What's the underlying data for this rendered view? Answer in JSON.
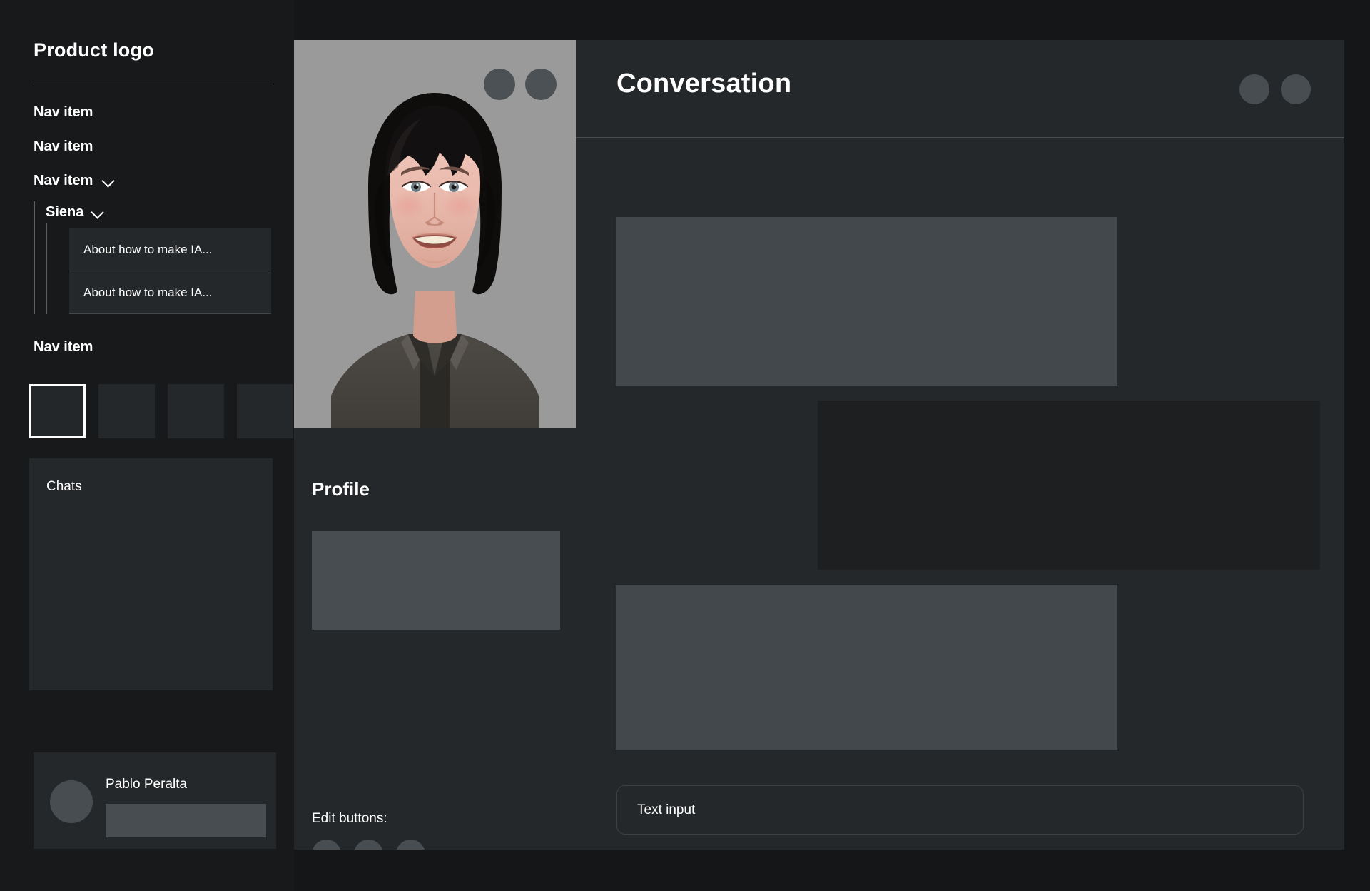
{
  "sidebar": {
    "logo": "Product logo",
    "nav_items": [
      {
        "label": "Nav item",
        "has_chevron": false
      },
      {
        "label": "Nav item",
        "has_chevron": false
      },
      {
        "label": "Nav item",
        "has_chevron": true
      }
    ],
    "subtree": {
      "label": "Siena",
      "has_chevron": true,
      "chats": [
        {
          "label": "About how to make IA..."
        },
        {
          "label": "About how to make IA..."
        }
      ]
    },
    "nav_bottom": {
      "label": "Nav item"
    },
    "thumbnails": [
      {
        "selected": true
      },
      {
        "selected": false
      },
      {
        "selected": false
      },
      {
        "selected": false
      }
    ],
    "chats_panel": {
      "title": "Chats"
    },
    "user_card": {
      "name": "Pablo Peralta"
    }
  },
  "profile": {
    "title": "Profile",
    "photo_dots": 2,
    "edit_label": "Edit buttons:",
    "edit_dots": 3
  },
  "conversation": {
    "title": "Conversation",
    "header_dots": 2,
    "messages": [
      {
        "side": "left",
        "tone": "light"
      },
      {
        "side": "right",
        "tone": "dark"
      },
      {
        "side": "left",
        "tone": "light"
      }
    ],
    "input": {
      "value": "Text input",
      "placeholder": "Text input"
    }
  },
  "colors": {
    "page_bg": "#141617",
    "panel_bg": "#25282a",
    "sidebar_bg": "#18191b",
    "placeholder_light": "#474d50",
    "placeholder_dark": "#1d1f20",
    "divider": "#4a4d50",
    "text": "#ffffff",
    "photo_bg": "#9a9a9a"
  }
}
